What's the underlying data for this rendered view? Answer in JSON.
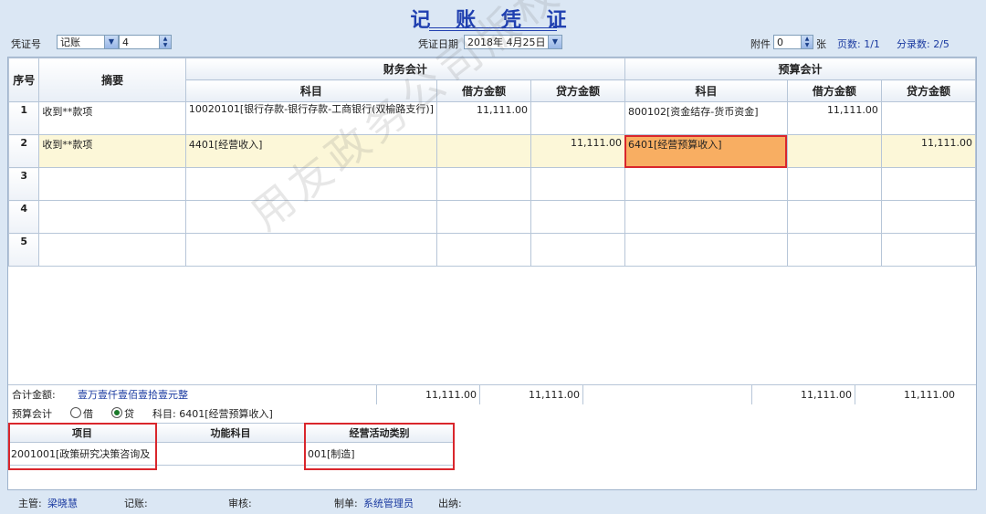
{
  "title": "记 账 凭 证",
  "toolbar": {
    "voucher_no_label": "凭证号",
    "voucher_type": "记账",
    "voucher_number": "4",
    "date_label": "凭证日期",
    "date_value": "2018年 4月25日",
    "attach_label": "附件",
    "attach_count": "0",
    "attach_unit": "张",
    "page_label": "页数: 1/1",
    "entry_count_label": "分录数: 2/5"
  },
  "table": {
    "group_headers": {
      "seq": "序号",
      "summary": "摘要",
      "financial": "财务会计",
      "budget": "预算会计"
    },
    "sub_headers": {
      "fin_subject": "科目",
      "fin_debit": "借方金额",
      "fin_credit": "贷方金额",
      "bud_subject": "科目",
      "bud_debit": "借方金额",
      "bud_credit": "贷方金额"
    },
    "rows": [
      {
        "idx": "1",
        "summary": "收到**款项",
        "fin_subject": "10020101[银行存款-银行存款-工商银行(双榆路支行)]",
        "fin_debit": "11,111.00",
        "fin_credit": "",
        "bud_subject": "800102[资金结存-货币资金]",
        "bud_debit": "11,111.00",
        "bud_credit": ""
      },
      {
        "idx": "2",
        "summary": "收到**款项",
        "fin_subject": "4401[经营收入]",
        "fin_debit": "",
        "fin_credit": "11,111.00",
        "bud_subject": "6401[经营预算收入]",
        "bud_debit": "",
        "bud_credit": "11,111.00"
      },
      {
        "idx": "3",
        "summary": "",
        "fin_subject": "",
        "fin_debit": "",
        "fin_credit": "",
        "bud_subject": "",
        "bud_debit": "",
        "bud_credit": ""
      },
      {
        "idx": "4",
        "summary": "",
        "fin_subject": "",
        "fin_debit": "",
        "fin_credit": "",
        "bud_subject": "",
        "bud_debit": "",
        "bud_credit": ""
      },
      {
        "idx": "5",
        "summary": "",
        "fin_subject": "",
        "fin_debit": "",
        "fin_credit": "",
        "bud_subject": "",
        "bud_debit": "",
        "bud_credit": ""
      }
    ]
  },
  "totals": {
    "label": "合计金额:",
    "in_words": "壹万壹仟壹佰壹拾壹元整",
    "fin_debit": "11,111.00",
    "fin_credit": "11,111.00",
    "bud_debit": "11,111.00",
    "bud_credit": "11,111.00"
  },
  "budget_line": {
    "label": "预算会计",
    "opt_debit": "借",
    "opt_credit": "贷",
    "subject_label": "科目: 6401[经营预算收入]"
  },
  "aux": {
    "project_header": "项目",
    "project_value": "2001001[政策研究决策咨询及",
    "func_header": "功能科目",
    "func_value": "",
    "activity_header": "经营活动类别",
    "activity_value": "001[制造]"
  },
  "footer": {
    "supervisor": "主管:",
    "supervisor_name": "梁晓慧",
    "bookkeeper": "记账:",
    "auditor": "审核:",
    "maker": "制单:",
    "maker_name": "系统管理员",
    "cashier": "出纳:"
  },
  "watermark": "用友政务公司版权所有",
  "colors": {
    "title": "#2040b0",
    "highlight": "#f8ae62",
    "annotation": "#d9262c",
    "selected_row": "#fcf7d8"
  }
}
